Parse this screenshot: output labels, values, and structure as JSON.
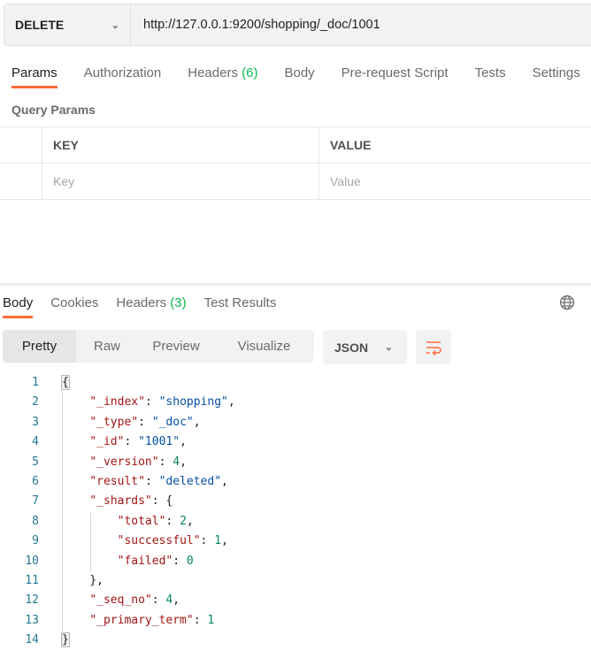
{
  "request": {
    "method": "DELETE",
    "url": "http://127.0.0.1:9200/shopping/_doc/1001"
  },
  "request_tabs": [
    {
      "label": "Params",
      "active": true
    },
    {
      "label": "Authorization"
    },
    {
      "label": "Headers",
      "count": "(6)"
    },
    {
      "label": "Body"
    },
    {
      "label": "Pre-request Script"
    },
    {
      "label": "Tests"
    },
    {
      "label": "Settings"
    }
  ],
  "query_params": {
    "title": "Query Params",
    "key_header": "KEY",
    "value_header": "VALUE",
    "key_placeholder": "Key",
    "value_placeholder": "Value"
  },
  "response_tabs": [
    {
      "label": "Body",
      "active": true
    },
    {
      "label": "Cookies"
    },
    {
      "label": "Headers",
      "count": "(3)"
    },
    {
      "label": "Test Results"
    }
  ],
  "view_modes": [
    {
      "label": "Pretty",
      "active": true
    },
    {
      "label": "Raw"
    },
    {
      "label": "Preview"
    },
    {
      "label": "Visualize"
    }
  ],
  "format": "JSON",
  "colors": {
    "accent": "#ff6c37",
    "count": "#0cbb52",
    "key": "#a31515",
    "string": "#0451a5",
    "number": "#098658"
  },
  "code_lines": [
    [
      [
        "p",
        "{"
      ]
    ],
    [
      [
        "p",
        "    "
      ],
      [
        "k",
        "\"_index\""
      ],
      [
        "p",
        ": "
      ],
      [
        "s",
        "\"shopping\""
      ],
      [
        "p",
        ","
      ]
    ],
    [
      [
        "p",
        "    "
      ],
      [
        "k",
        "\"_type\""
      ],
      [
        "p",
        ": "
      ],
      [
        "s",
        "\"_doc\""
      ],
      [
        "p",
        ","
      ]
    ],
    [
      [
        "p",
        "    "
      ],
      [
        "k",
        "\"_id\""
      ],
      [
        "p",
        ": "
      ],
      [
        "s",
        "\"1001\""
      ],
      [
        "p",
        ","
      ]
    ],
    [
      [
        "p",
        "    "
      ],
      [
        "k",
        "\"_version\""
      ],
      [
        "p",
        ": "
      ],
      [
        "n",
        "4"
      ],
      [
        "p",
        ","
      ]
    ],
    [
      [
        "p",
        "    "
      ],
      [
        "k",
        "\"result\""
      ],
      [
        "p",
        ": "
      ],
      [
        "s",
        "\"deleted\""
      ],
      [
        "p",
        ","
      ]
    ],
    [
      [
        "p",
        "    "
      ],
      [
        "k",
        "\"_shards\""
      ],
      [
        "p",
        ": {"
      ]
    ],
    [
      [
        "p",
        "        "
      ],
      [
        "k",
        "\"total\""
      ],
      [
        "p",
        ": "
      ],
      [
        "n",
        "2"
      ],
      [
        "p",
        ","
      ]
    ],
    [
      [
        "p",
        "        "
      ],
      [
        "k",
        "\"successful\""
      ],
      [
        "p",
        ": "
      ],
      [
        "n",
        "1"
      ],
      [
        "p",
        ","
      ]
    ],
    [
      [
        "p",
        "        "
      ],
      [
        "k",
        "\"failed\""
      ],
      [
        "p",
        ": "
      ],
      [
        "n",
        "0"
      ]
    ],
    [
      [
        "p",
        "    },"
      ]
    ],
    [
      [
        "p",
        "    "
      ],
      [
        "k",
        "\"_seq_no\""
      ],
      [
        "p",
        ": "
      ],
      [
        "n",
        "4"
      ],
      [
        "p",
        ","
      ]
    ],
    [
      [
        "p",
        "    "
      ],
      [
        "k",
        "\"_primary_term\""
      ],
      [
        "p",
        ": "
      ],
      [
        "n",
        "1"
      ]
    ],
    [
      [
        "p",
        "}"
      ]
    ]
  ]
}
